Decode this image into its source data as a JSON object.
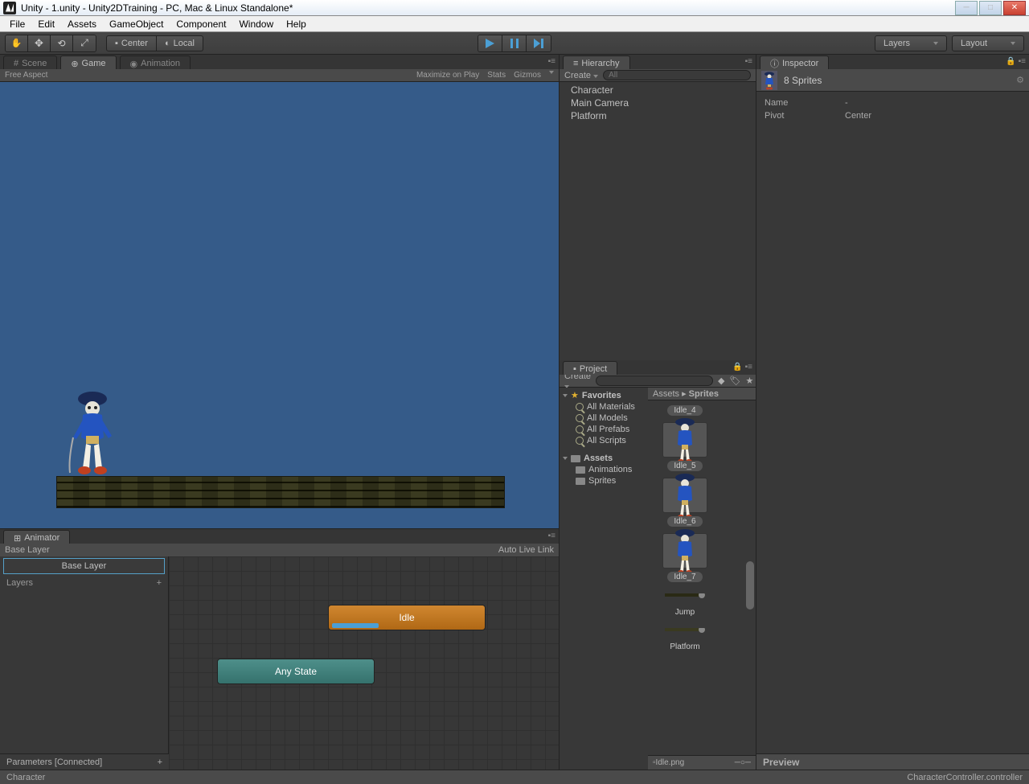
{
  "window": {
    "title": "Unity - 1.unity - Unity2DTraining - PC, Mac & Linux Standalone*"
  },
  "menu": [
    "File",
    "Edit",
    "Assets",
    "GameObject",
    "Component",
    "Window",
    "Help"
  ],
  "toolbar": {
    "pivot_center": "Center",
    "pivot_local": "Local",
    "layers": "Layers",
    "layout": "Layout"
  },
  "game_panel": {
    "tabs": [
      "Scene",
      "Game",
      "Animation"
    ],
    "active_tab": 1,
    "aspect": "Free Aspect",
    "options": [
      "Maximize on Play",
      "Stats",
      "Gizmos"
    ]
  },
  "animator": {
    "tab": "Animator",
    "breadcrumb": "Base Layer",
    "auto_live": "Auto Live Link",
    "layer_selected": "Base Layer",
    "layers_label": "Layers",
    "params": "Parameters [Connected]",
    "states": {
      "idle": "Idle",
      "any": "Any State"
    },
    "status_left": "Character",
    "status_right": "CharacterController.controller"
  },
  "hierarchy": {
    "tab": "Hierarchy",
    "create": "Create",
    "search_placeholder": "All",
    "items": [
      "Character",
      "Main Camera",
      "Platform"
    ]
  },
  "project": {
    "tab": "Project",
    "create": "Create",
    "favorites": "Favorites",
    "filters": [
      "All Materials",
      "All Models",
      "All Prefabs",
      "All Scripts"
    ],
    "assets": "Assets",
    "folders": [
      "Animations",
      "Sprites"
    ],
    "breadcrumb": [
      "Assets",
      "Sprites"
    ],
    "items": [
      "Idle_4",
      "Idle_5",
      "Idle_6",
      "Idle_7",
      "Jump",
      "Platform"
    ],
    "footer": "Idle.png"
  },
  "inspector": {
    "tab": "Inspector",
    "title": "8 Sprites",
    "rows": [
      {
        "k": "Name",
        "v": "-"
      },
      {
        "k": "Pivot",
        "v": "Center"
      }
    ],
    "preview": "Preview"
  }
}
